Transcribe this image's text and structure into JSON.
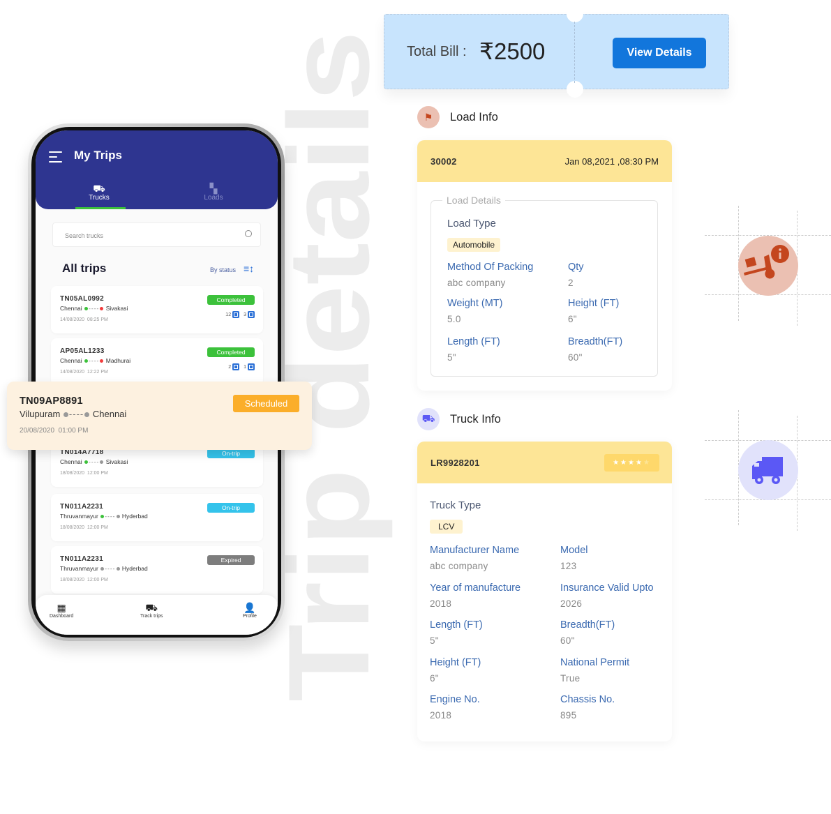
{
  "watermark": "Trip details",
  "colors": {
    "header": "#2e3590",
    "completed": "#3cc13b",
    "ontrip": "#34c3eb",
    "expired": "#7d7d7d",
    "scheduled": "#fbae2a",
    "accent": "#1276dc",
    "card_header": "#fde596",
    "ticket": "#c8e4fd"
  },
  "phone": {
    "title": "My Trips",
    "tabs": [
      {
        "label": "Trucks",
        "icon": "truck-icon",
        "active": true
      },
      {
        "label": "Loads",
        "icon": "boxes-icon",
        "active": false
      }
    ],
    "search": {
      "placeholder": "Search trucks"
    },
    "section_title": "All trips",
    "sort_label": "By status",
    "trips": [
      {
        "id": "TN05AL0992",
        "from": "Chennai",
        "to": "Sivakasi",
        "datetime": "14/08/2020  08:25 PM",
        "status": "Completed",
        "count_a": "12",
        "count_b": "3"
      },
      {
        "id": "AP05AL1233",
        "from": "Chennai",
        "to": "Madhurai",
        "datetime": "14/08/2020  12:22 PM",
        "status": "Completed",
        "count_a": "2",
        "count_b": "1"
      },
      {
        "id": "TN014A7718",
        "from": "Chennai",
        "to": "Sivakasi",
        "datetime": "18/08/2020  12:00 PM",
        "status": "On-trip"
      },
      {
        "id": "TN011A2231",
        "from": "Thruvanmayur",
        "to": "Hyderbad",
        "datetime": "18/08/2020  12:00 PM",
        "status": "On-trip"
      },
      {
        "id": "TN011A2231",
        "from": "Thruvanmayur",
        "to": "Hyderbad",
        "datetime": "18/08/2020  12:00 PM",
        "status": "Expired"
      }
    ],
    "highlighted_trip": {
      "id": "TN09AP8891",
      "from": "Vilupuram",
      "to": "Chennai",
      "datetime": "20/08/2020  01:00 PM",
      "status": "Scheduled"
    },
    "bottom_nav": [
      {
        "label": "Dashboard",
        "icon": "dashboard-icon"
      },
      {
        "label": "Track trips",
        "icon": "track-truck-icon"
      },
      {
        "label": "Profile",
        "icon": "profile-icon"
      }
    ]
  },
  "bill": {
    "label": "Total Bill :",
    "amount": "₹2500",
    "button": "View Details"
  },
  "load_info": {
    "title": "Load Info",
    "id": "30002",
    "datetime": "Jan 08,2021 ,08:30 PM",
    "legend": "Load Details",
    "type_label": "Load Type",
    "type_value": "Automobile",
    "fields": [
      {
        "label": "Method Of Packing",
        "value": "abc company"
      },
      {
        "label": "Qty",
        "value": "2"
      },
      {
        "label": "Weight (MT)",
        "value": "5.0"
      },
      {
        "label": "Height (FT)",
        "value": "6\""
      },
      {
        "label": "Length (FT)",
        "value": "5\""
      },
      {
        "label": "Breadth(FT)",
        "value": "60\""
      }
    ]
  },
  "truck_info": {
    "title": "Truck Info",
    "id": "LR9928201",
    "rating": 4,
    "rating_max": 5,
    "type_label": "Truck Type",
    "type_value": "LCV",
    "fields": [
      {
        "label": "Manufacturer Name",
        "value": "abc company"
      },
      {
        "label": "Model",
        "value": "123"
      },
      {
        "label": "Year of manufacture",
        "value": "2018"
      },
      {
        "label": "Insurance Valid Upto",
        "value": "2026"
      },
      {
        "label": "Length (FT)",
        "value": "5\""
      },
      {
        "label": "Breadth(FT)",
        "value": "60\""
      },
      {
        "label": "Height (FT)",
        "value": "6\""
      },
      {
        "label": "National Permit",
        "value": "True"
      },
      {
        "label": "Engine No.",
        "value": "2018"
      },
      {
        "label": "Chassis No.",
        "value": "895"
      }
    ]
  }
}
